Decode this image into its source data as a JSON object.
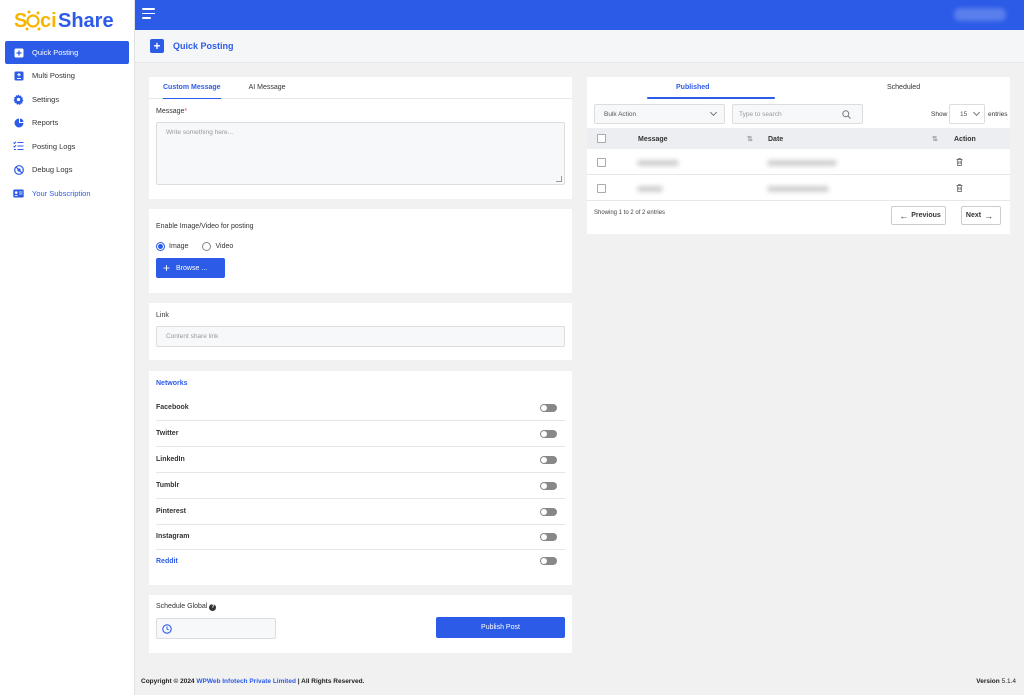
{
  "brand": {
    "logo_text_soci": "Soci",
    "logo_text_share": "Share",
    "primary_color": "#2c5be8",
    "accent_color": "#f7b500"
  },
  "sidebar": {
    "items": [
      {
        "label": "Quick Posting",
        "icon": "plus-square-icon",
        "active": true
      },
      {
        "label": "Multi Posting",
        "icon": "plus-minus-icon",
        "active": false
      },
      {
        "label": "Settings",
        "icon": "gear-icon",
        "active": false
      },
      {
        "label": "Reports",
        "icon": "pie-chart-icon",
        "active": false
      },
      {
        "label": "Posting Logs",
        "icon": "list-check-icon",
        "active": false
      },
      {
        "label": "Debug Logs",
        "icon": "bug-off-icon",
        "active": false
      },
      {
        "label": "Your Subscription",
        "icon": "id-card-icon",
        "active": false
      }
    ]
  },
  "page": {
    "title": "Quick Posting"
  },
  "compose": {
    "tabs": [
      "Custom Message",
      "AI Message"
    ],
    "message_label": "Message",
    "required_mark": "*",
    "message_placeholder": "Write something here..."
  },
  "media": {
    "label": "Enable Image/Video for posting",
    "options": [
      "Image",
      "Video"
    ],
    "selected": "Image",
    "browse_label": "Browse ..."
  },
  "link": {
    "label": "Link",
    "placeholder": "Content share link"
  },
  "networks": {
    "title": "Networks",
    "items": [
      "Facebook",
      "Twitter",
      "LinkedIn",
      "Tumblr",
      "Pinterest",
      "Instagram",
      "Reddit"
    ]
  },
  "schedule": {
    "label": "Schedule Global",
    "publish_label": "Publish Post"
  },
  "posts": {
    "tabs": [
      "Published",
      "Scheduled"
    ],
    "bulk_action": "Bulk Action",
    "search_placeholder": "Type to search",
    "show_label": "Show",
    "entries_value": "15",
    "entries_label": "entries",
    "columns": [
      "Message",
      "Date",
      "Action"
    ],
    "info": "Showing 1 to 2 of 2 entries",
    "prev_label": "Previous",
    "next_label": "Next"
  },
  "footer": {
    "copyright_prefix": "Copyright © 2024",
    "company": "WPWeb Infotech Private Limited",
    "rights": "| All Rights Reserved.",
    "version_label": "Version",
    "version_value": "5.1.4"
  }
}
